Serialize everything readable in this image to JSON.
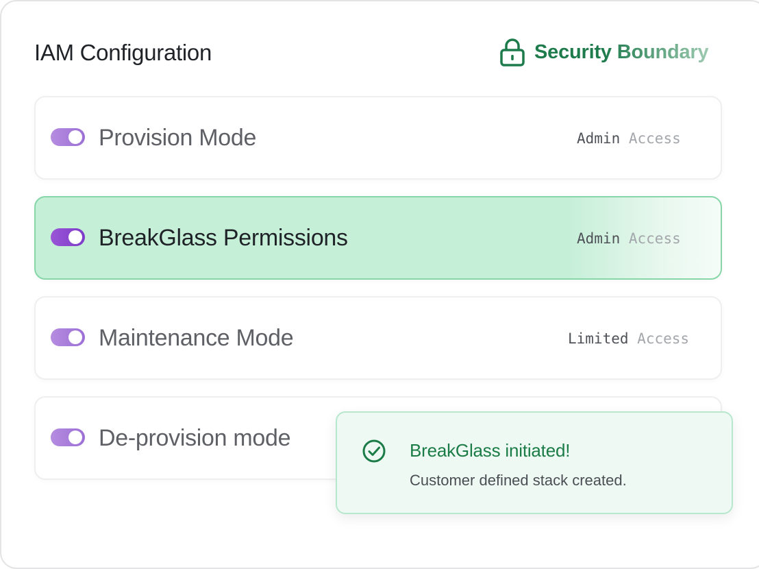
{
  "header": {
    "title": "IAM Configuration",
    "security": {
      "icon": "lock-icon",
      "label": "Security Boundary"
    }
  },
  "modes": [
    {
      "label": "Provision Mode",
      "enabled": true,
      "access_level": "Admin",
      "access_word": "Access"
    },
    {
      "label": "BreakGlass Permissions",
      "enabled": true,
      "selected": true,
      "access_level": "Admin",
      "access_word": "Access"
    },
    {
      "label": "Maintenance Mode",
      "enabled": true,
      "access_level": "Limited",
      "access_word": "Access"
    },
    {
      "label": "De-provision mode",
      "enabled": true
    }
  ],
  "toast": {
    "icon": "check-circle-icon",
    "title": "BreakGlass initiated!",
    "message": "Customer defined stack created."
  },
  "colors": {
    "accent_green": "#1e7b4c",
    "toggle_purple": "#9c6fd6",
    "selected_row": "#c6efd8"
  }
}
